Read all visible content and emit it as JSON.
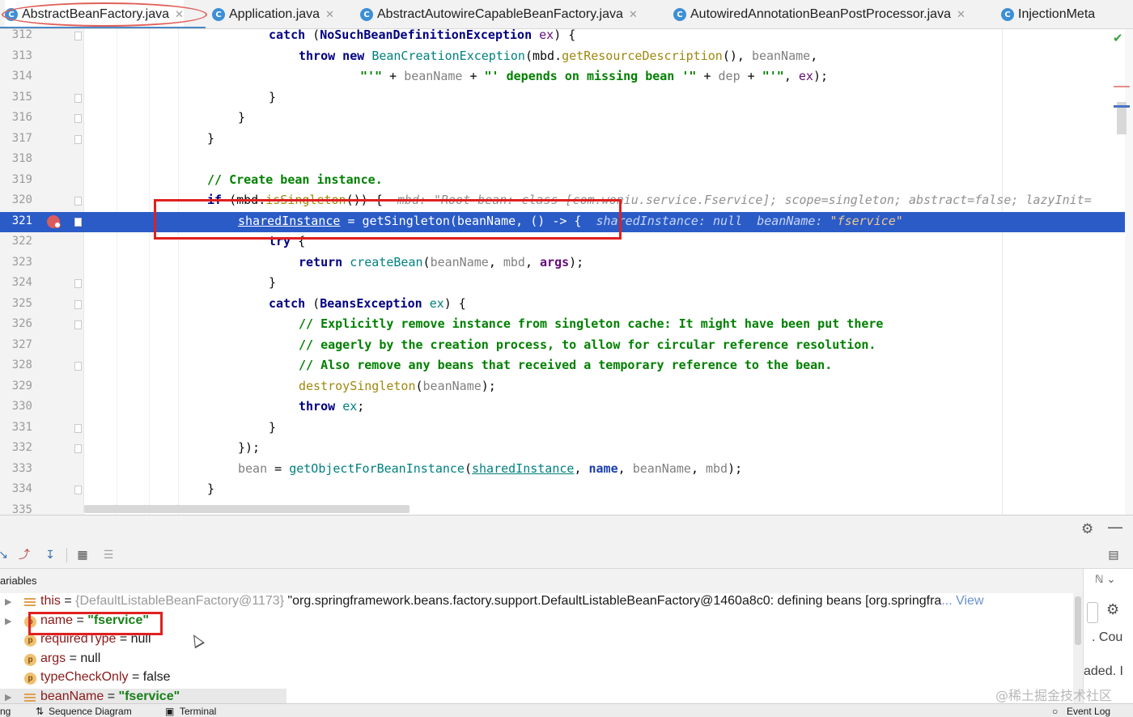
{
  "tabs": [
    {
      "label": "AbstractBeanFactory.java",
      "active": true,
      "closable": true
    },
    {
      "label": "Application.java",
      "active": false,
      "closable": true
    },
    {
      "label": "AbstractAutowireCapableBeanFactory.java",
      "active": false,
      "closable": true
    },
    {
      "label": "AutowiredAnnotationBeanPostProcessor.java",
      "active": false,
      "closable": true
    },
    {
      "label": "InjectionMeta",
      "active": false,
      "closable": false
    }
  ],
  "editor": {
    "lines": [
      {
        "num": "312"
      },
      {
        "num": "313"
      },
      {
        "num": "314"
      },
      {
        "num": "315"
      },
      {
        "num": "316"
      },
      {
        "num": "317"
      },
      {
        "num": "318"
      },
      {
        "num": "319"
      },
      {
        "num": "320"
      },
      {
        "num": "321"
      },
      {
        "num": "322"
      },
      {
        "num": "323"
      },
      {
        "num": "324"
      },
      {
        "num": "325"
      },
      {
        "num": "326"
      },
      {
        "num": "327"
      },
      {
        "num": "328"
      },
      {
        "num": "329"
      },
      {
        "num": "330"
      },
      {
        "num": "331"
      },
      {
        "num": "332"
      },
      {
        "num": "333"
      },
      {
        "num": "334"
      },
      {
        "num": "335"
      }
    ],
    "code": {
      "l312": {
        "kw": "catch",
        "p1": " (",
        "cls": "NoSuchBeanDefinitionException",
        "sp": " ",
        "var": "ex",
        "p2": ") {"
      },
      "l313": {
        "kw": "throw new ",
        "cls": "BeanCreationException",
        "p1": "(mbd.",
        "m1": "getResourceDescription",
        "p2": "(), ",
        "v1": "beanName",
        "p3": ","
      },
      "l314": {
        "s1": "\"'\"",
        "p1": " + ",
        "v1": "beanName",
        "p2": " + ",
        "s2": "\"' depends on missing bean '\"",
        "p3": " + ",
        "v2": "dep",
        "p4": " + ",
        "s3": "\"'\"",
        "p5": ", ",
        "v3": "ex",
        "p6": ");"
      },
      "l315": {
        "p1": "}"
      },
      "l316": {
        "p1": "}"
      },
      "l317": {
        "p1": "}"
      },
      "l319": {
        "cmt": "// Create bean instance."
      },
      "l320": {
        "kw": "if",
        "p1": " (mbd.",
        "m1": "isSingleton",
        "p2": "()) {",
        "hint": "mbd: \"Root bean: class [com.woniu.service.Fservice]; scope=singleton; abstract=false; lazyInit="
      },
      "l321": {
        "f1": "sharedInstance",
        "p1": " = getSingleton(beanName, () -> {",
        "h1": "sharedInstance: null",
        "h2": "beanName: ",
        "h3": "\"fservice\""
      },
      "l322": {
        "kw": "try",
        "p1": " {"
      },
      "l323": {
        "kw": "return ",
        "m1": "createBean",
        "p1": "(",
        "v1": "beanName",
        "p2": ", ",
        "v2": "mbd",
        "p3": ", ",
        "f1": "args",
        "p4": ");"
      },
      "l324": {
        "p1": "}"
      },
      "l325": {
        "kw": "catch",
        "p1": " (",
        "cls": "BeansException",
        "sp": " ",
        "var": "ex",
        "p2": ") {"
      },
      "l326": {
        "cmt": "// Explicitly remove instance from singleton cache: It might have been put there"
      },
      "l327": {
        "cmt": "// eagerly by the creation process, to allow for circular reference resolution."
      },
      "l328": {
        "cmt": "// Also remove any beans that received a temporary reference to the bean."
      },
      "l329": {
        "m1": "destroySingleton",
        "p1": "(",
        "v1": "beanName",
        "p2": ");"
      },
      "l330": {
        "kw": "throw ",
        "var": "ex",
        "p1": ";"
      },
      "l331": {
        "p1": "}"
      },
      "l332": {
        "p1": "});"
      },
      "l333": {
        "v1": "bean",
        "p1": " = ",
        "m1": "getObjectForBeanInstance",
        "p2": "(",
        "f1": "sharedInstance",
        "p3": ", ",
        "f2": "name",
        "p4": ", ",
        "v2": "beanName",
        "p5": ", ",
        "v3": "mbd",
        "p6": ");"
      },
      "l334": {
        "p1": "}"
      }
    }
  },
  "debug": {
    "variables_label": "ariables",
    "variables": [
      {
        "name": "this",
        "eq": " = ",
        "type": "{DefaultListableBeanFactory@1173}",
        "value": " \"org.springframework.beans.factory.support.DefaultListableBeanFactory@1460a8c0: defining beans [org.springfra",
        "more": "... View"
      },
      {
        "name": "name",
        "eq": " = ",
        "value": "\"fservice\""
      },
      {
        "name": "requiredType",
        "eq": " = ",
        "value": "null"
      },
      {
        "name": "args",
        "eq": " = ",
        "value": "null"
      },
      {
        "name": "typeCheckOnly",
        "eq": " = ",
        "value": "false"
      },
      {
        "name": "beanName",
        "eq": " = ",
        "value": "\"fservice\""
      }
    ],
    "right_panel": {
      "cou": ". Cou",
      "loaded": "aded. I"
    },
    "bottom_tabs": {
      "left": "ng",
      "seq": "Sequence Diagram",
      "term": "Terminal",
      "event": "Event Log"
    },
    "watermark": "@稀土掘金技术社区"
  },
  "colors": {
    "accent": "#2a5bc7",
    "breakpoint": "#db5c5c",
    "annotation_box": "#e02020"
  }
}
